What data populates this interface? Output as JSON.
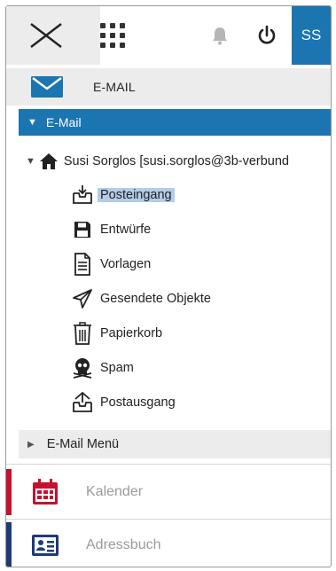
{
  "topbar": {
    "close_icon": "close-icon",
    "apps_icon": "apps-grid-icon",
    "bell_icon": "bell-icon",
    "power_icon": "power-icon",
    "user_initials": "SS",
    "accent": "#1b75b0"
  },
  "mail_header": {
    "label": "E-MAIL",
    "icon": "envelope-icon"
  },
  "section": {
    "label": "E-Mail"
  },
  "account": {
    "label": "Susi Sorglos [susi.sorglos@3b-verbund"
  },
  "folders": [
    {
      "label": "Posteingang",
      "icon": "inbox-icon",
      "selected": true
    },
    {
      "label": "Entwürfe",
      "icon": "floppy-disk-icon"
    },
    {
      "label": "Vorlagen",
      "icon": "document-icon"
    },
    {
      "label": "Gesendete Objekte",
      "icon": "paper-plane-icon"
    },
    {
      "label": "Papierkorb",
      "icon": "trash-icon"
    },
    {
      "label": "Spam",
      "icon": "skull-icon"
    },
    {
      "label": "Postausgang",
      "icon": "outbox-icon"
    }
  ],
  "email_menu": {
    "label": "E-Mail Menü"
  },
  "modules": [
    {
      "label": "Kalender",
      "icon": "calendar-icon",
      "color": "#c8102e"
    },
    {
      "label": "Adressbuch",
      "icon": "contact-card-icon",
      "color": "#1e3a78"
    }
  ]
}
